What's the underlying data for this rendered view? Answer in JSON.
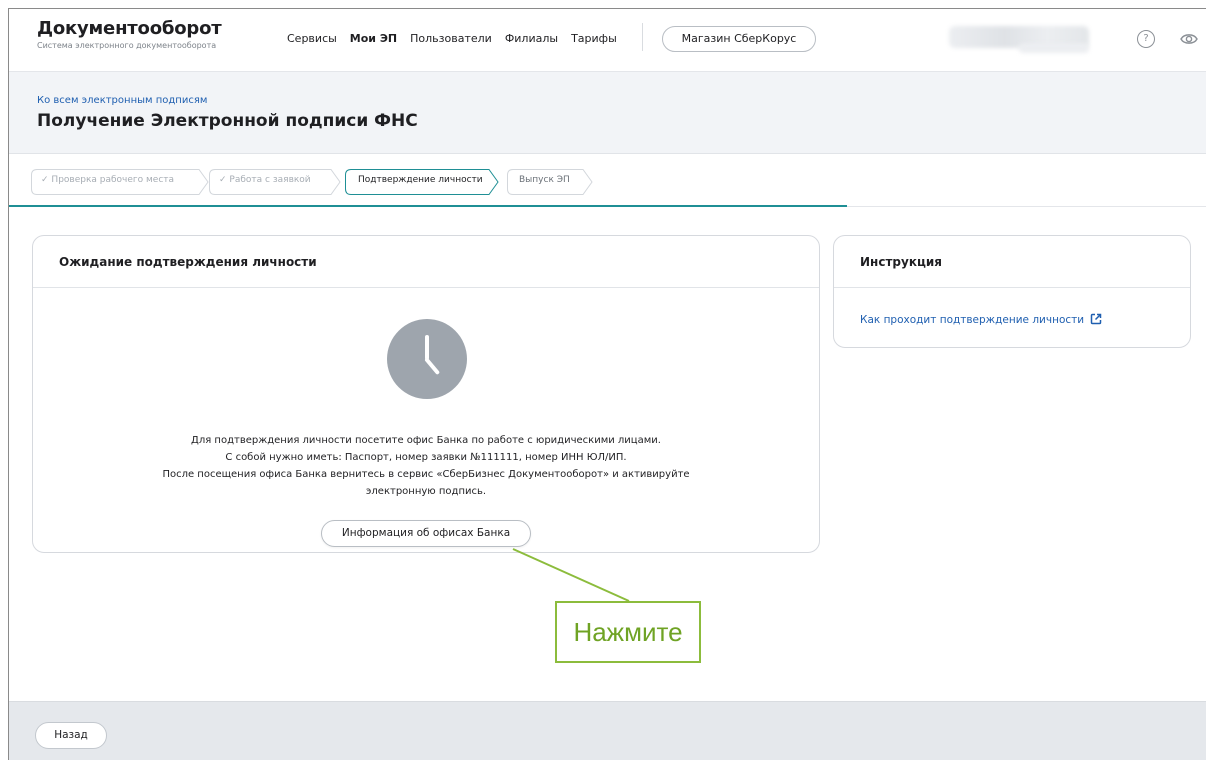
{
  "header": {
    "brand_title": "Документооборот",
    "brand_subtitle": "Система электронного документооборота",
    "nav": [
      {
        "label": "Сервисы",
        "active": false
      },
      {
        "label": "Мои ЭП",
        "active": true
      },
      {
        "label": "Пользователи",
        "active": false
      },
      {
        "label": "Филиалы",
        "active": false
      },
      {
        "label": "Тарифы",
        "active": false
      }
    ],
    "store_button": "Магазин СберКорус",
    "help_icon": "question-circle-icon",
    "eye_icon": "eye-icon"
  },
  "titleband": {
    "back_link": "Ко всем электронным подписям",
    "page_title": "Получение Электронной подписи ФНС"
  },
  "steps": [
    {
      "label": "Проверка рабочего места",
      "state": "done"
    },
    {
      "label": "Работа с заявкой",
      "state": "done"
    },
    {
      "label": "Подтверждение личности",
      "state": "current"
    },
    {
      "label": "Выпуск ЭП",
      "state": "pending"
    }
  ],
  "main_card": {
    "title": "Ожидание подтверждения личности",
    "icon": "clock-icon",
    "lines": [
      "Для подтверждения личности посетите офис Банка по работе с юридическими лицами.",
      "С собой нужно иметь: Паспорт, номер заявки №111111, номер ИНН ЮЛ/ИП.",
      "После посещения офиса Банка вернитесь в сервис «СберБизнес Документооборот» и активируйте",
      "электронную подпись."
    ],
    "button": "Информация об офисах Банка"
  },
  "side_card": {
    "title": "Инструкция",
    "link": "Как проходит подтверждение личности",
    "link_icon": "external-link-icon"
  },
  "footer": {
    "back_button": "Назад"
  },
  "annotation": {
    "text": "Нажмите"
  },
  "colors": {
    "accent": "#1f8f95",
    "link": "#1f5fb0",
    "annotation": "#8cbc3c"
  }
}
